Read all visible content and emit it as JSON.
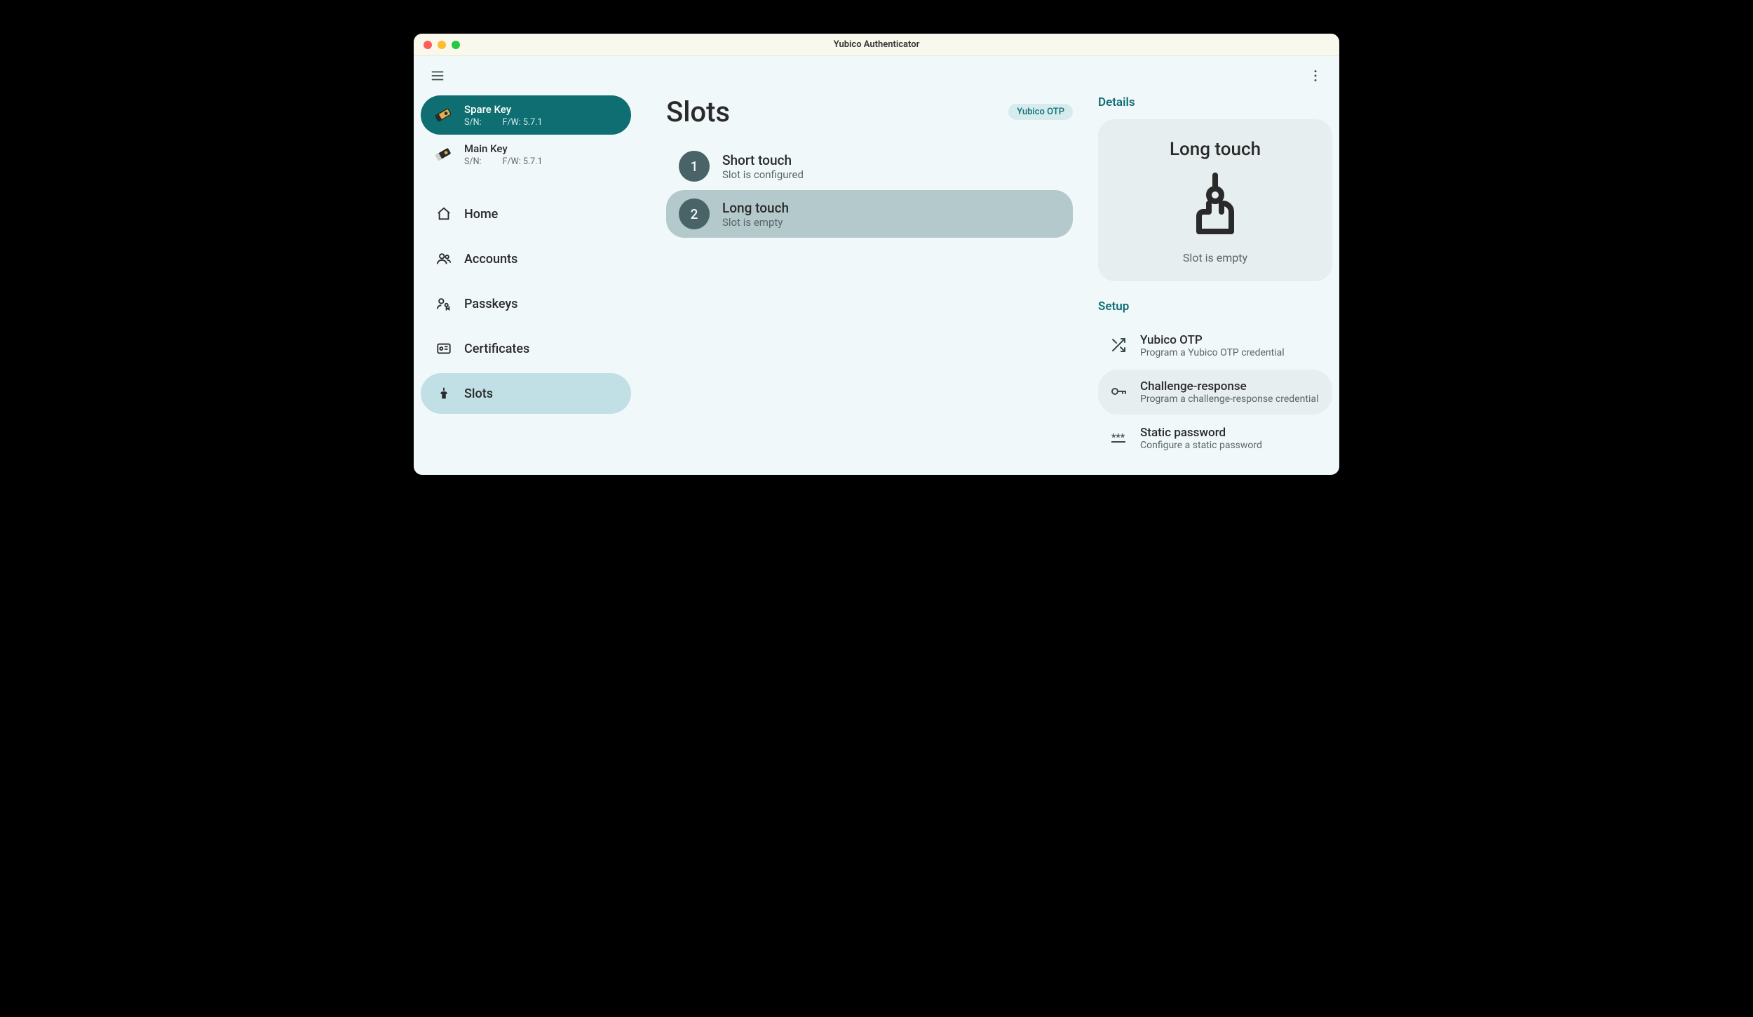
{
  "window": {
    "title": "Yubico Authenticator"
  },
  "devices": [
    {
      "name": "Spare Key",
      "sn_label": "S/N:",
      "fw_label": "F/W: 5.7.1",
      "active": true
    },
    {
      "name": "Main Key",
      "sn_label": "S/N:",
      "fw_label": "F/W: 5.7.1",
      "active": false
    }
  ],
  "nav": {
    "home": "Home",
    "accounts": "Accounts",
    "passkeys": "Passkeys",
    "certificates": "Certificates",
    "slots": "Slots"
  },
  "main": {
    "title": "Slots",
    "chip": "Yubico OTP",
    "slots": [
      {
        "num": "1",
        "name": "Short touch",
        "status": "Slot is configured"
      },
      {
        "num": "2",
        "name": "Long touch",
        "status": "Slot is empty"
      }
    ]
  },
  "details": {
    "heading": "Details",
    "title": "Long touch",
    "status": "Slot is empty"
  },
  "setup": {
    "heading": "Setup",
    "items": [
      {
        "name": "Yubico OTP",
        "desc": "Program a Yubico OTP credential"
      },
      {
        "name": "Challenge-response",
        "desc": "Program a challenge-response credential"
      },
      {
        "name": "Static password",
        "desc": "Configure a static password"
      }
    ]
  }
}
